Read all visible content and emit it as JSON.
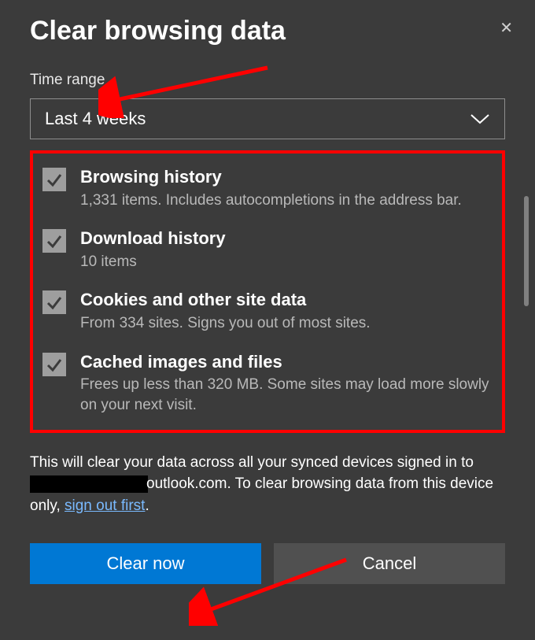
{
  "dialog": {
    "title": "Clear browsing data",
    "time_range_label": "Time range",
    "time_range_value": "Last 4 weeks",
    "options": [
      {
        "title": "Browsing history",
        "desc": "1,331 items. Includes autocompletions in the address bar."
      },
      {
        "title": "Download history",
        "desc": "10 items"
      },
      {
        "title": "Cookies and other site data",
        "desc": "From 334 sites. Signs you out of most sites."
      },
      {
        "title": "Cached images and files",
        "desc": "Frees up less than 320 MB. Some sites may load more slowly on your next visit."
      }
    ],
    "info_pre": "This will clear your data across all your synced devices signed in to ",
    "info_mid": "outlook.com. To clear browsing data from this device only, ",
    "info_link": "sign out first",
    "info_post": ".",
    "clear_btn": "Clear now",
    "cancel_btn": "Cancel"
  }
}
